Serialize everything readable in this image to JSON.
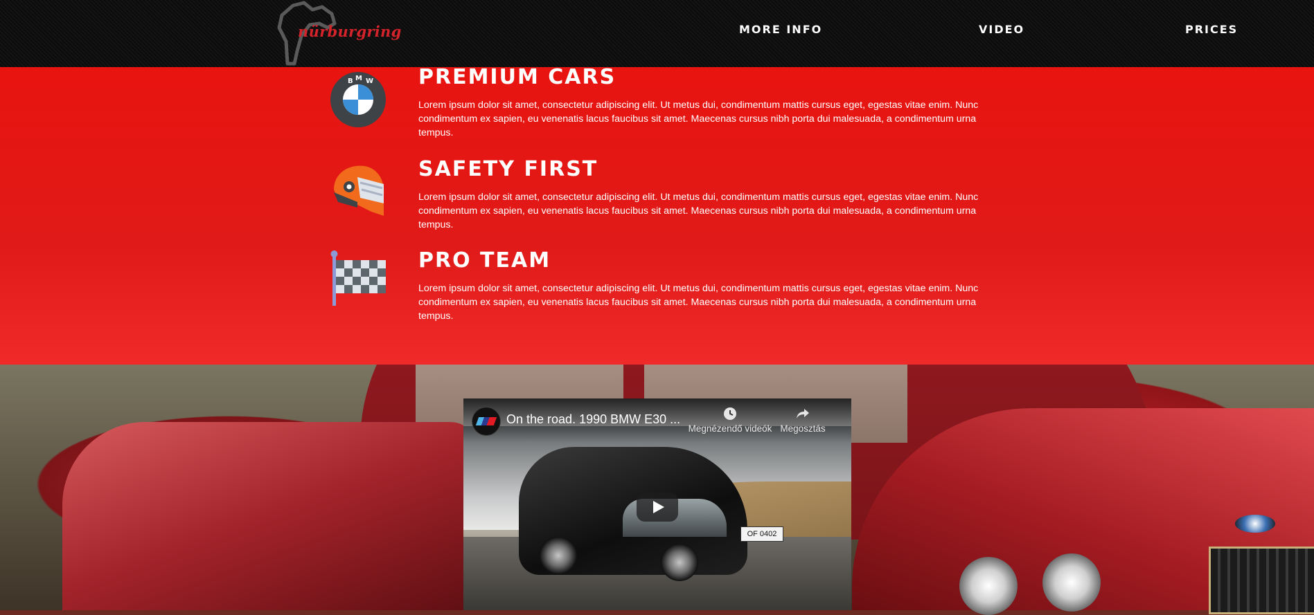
{
  "header": {
    "logo_text": "nürburgring",
    "nav": [
      {
        "label": "MORE INFO"
      },
      {
        "label": "VIDEO"
      },
      {
        "label": "PRICES"
      }
    ]
  },
  "features": [
    {
      "icon": "bmw-logo-icon",
      "title": "PREMIUM CARS",
      "text": "Lorem ipsum dolor sit amet, consectetur adipiscing elit. Ut metus dui, condimentum mattis cursus eget, egestas vitae enim. Nunc condimentum ex sapien, eu venenatis lacus faucibus sit amet. Maecenas cursus nibh porta dui malesuada, a condimentum urna tempus."
    },
    {
      "icon": "racing-helmet-icon",
      "title": "SAFETY FIRST",
      "text": "Lorem ipsum dolor sit amet, consectetur adipiscing elit. Ut metus dui, condimentum mattis cursus eget, egestas vitae enim. Nunc condimentum ex sapien, eu venenatis lacus faucibus sit amet. Maecenas cursus nibh porta dui malesuada, a condimentum urna tempus."
    },
    {
      "icon": "checkered-flag-icon",
      "title": "PRO TEAM",
      "text": "Lorem ipsum dolor sit amet, consectetur adipiscing elit. Ut metus dui, condimentum mattis cursus eget, egestas vitae enim. Nunc condimentum ex sapien, eu venenatis lacus faucibus sit amet. Maecenas cursus nibh porta dui malesuada, a condimentum urna tempus."
    }
  ],
  "bmw_logo_letters": "BMW",
  "video": {
    "title": "On the road. 1990 BMW E30 ...",
    "watch_later": "Megnézendő videók",
    "share": "Megosztás",
    "plate_text": "OF 0402"
  },
  "colors": {
    "header_bg": "#0b0b0b",
    "feature_red": "#e81410",
    "logo_red": "#d4232a"
  }
}
